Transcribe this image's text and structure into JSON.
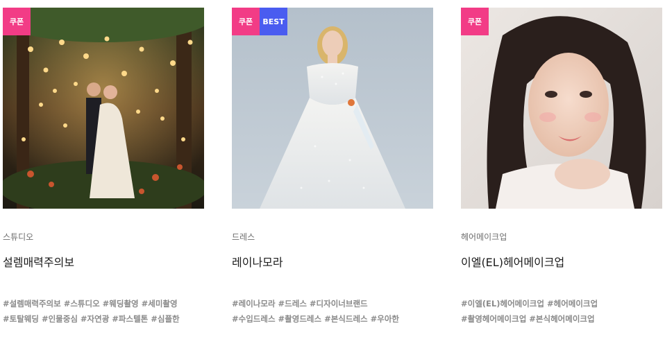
{
  "cards": [
    {
      "badges": [
        "쿠폰"
      ],
      "category": "스튜디오",
      "name": "설렘매력주의보",
      "tags_line1": "#설렘매력주의보 #스튜디오 #웨딩촬영 #세미촬영",
      "tags_line2": "#토탈웨딩 #인물중심 #자연광 #파스텔톤 #심플한",
      "image": "wedding-couple-forest-lights-photo"
    },
    {
      "badges": [
        "쿠폰",
        "BEST"
      ],
      "category": "드레스",
      "name": "레이나모라",
      "tags_line1": "#레이나모라 #드레스 #디자이너브랜드",
      "tags_line2": "#수입드레스 #촬영드레스 #본식드레스 #우아한",
      "image": "bride-white-gown-photo"
    },
    {
      "badges": [
        "쿠폰"
      ],
      "category": "헤어메이크업",
      "name": "이엘(EL)헤어메이크업",
      "tags_line1": "#이엘(EL)헤어메이크업 #헤어메이크업",
      "tags_line2": "#촬영헤어메이크업 #본식헤어메이크업",
      "image": "woman-makeup-portrait-photo"
    }
  ],
  "colors": {
    "coupon_badge": "#f23c86",
    "best_badge": "#4a5cf0"
  }
}
